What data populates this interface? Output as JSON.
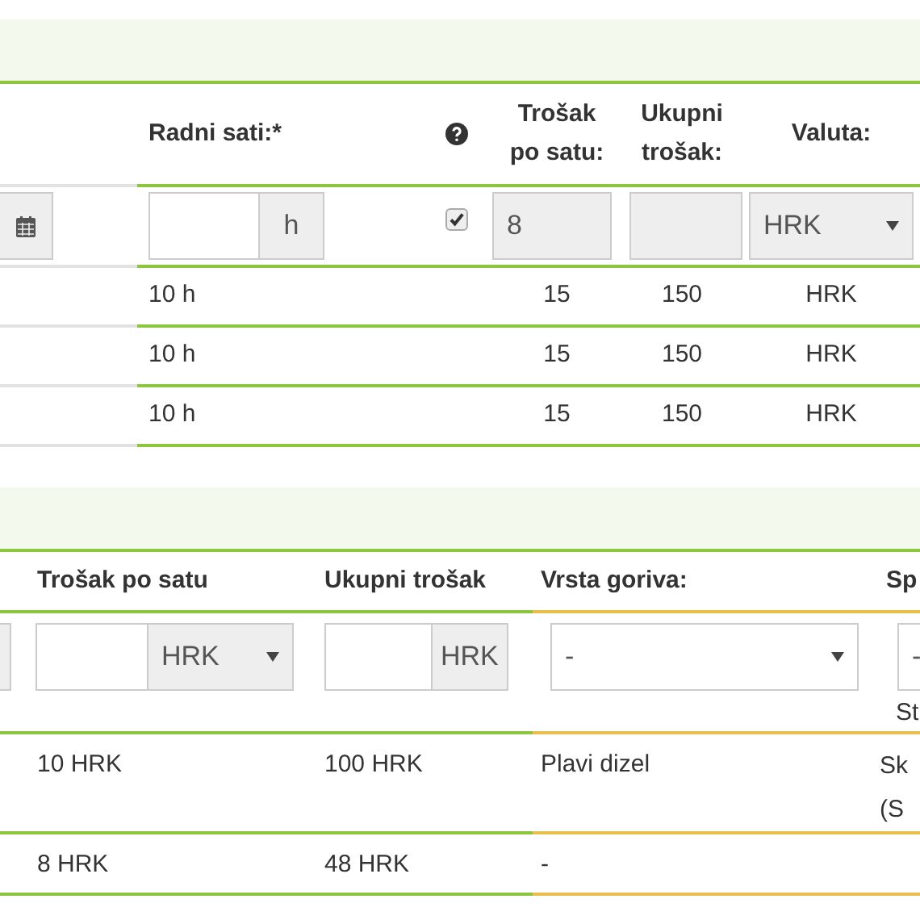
{
  "labour_table": {
    "headers": {
      "hours": "Radni sati:*",
      "hourly_cost": "Trošak po satu:",
      "total_cost": "Ukupni trošak:",
      "currency": "Valuta:"
    },
    "entry": {
      "hours_unit": "h",
      "checked": true,
      "hourly_cost": "8",
      "currency": "HRK"
    },
    "rows": [
      {
        "hours": "10 h",
        "hourly_cost": "15",
        "total_cost": "150",
        "currency": "HRK"
      },
      {
        "hours": "10 h",
        "hourly_cost": "15",
        "total_cost": "150",
        "currency": "HRK"
      },
      {
        "hours": "10 h",
        "hourly_cost": "15",
        "total_cost": "150",
        "currency": "HRK"
      }
    ]
  },
  "cost_table": {
    "headers": {
      "hourly_cost": "Trošak po satu",
      "total_cost": "Ukupni trošak",
      "fuel_type": "Vrsta goriva:",
      "column_5": "Sp"
    },
    "entry": {
      "hourly_currency": "HRK",
      "total_currency": "HRK",
      "fuel_type": "-",
      "column_5_value": "-",
      "column_5_note": "St"
    },
    "rows": [
      {
        "hourly_cost": "10 HRK",
        "total_cost": "100 HRK",
        "fuel_type": "Plavi dizel",
        "column_5": [
          "Sk",
          "(S"
        ]
      },
      {
        "hourly_cost": "8 HRK",
        "total_cost": "48 HRK",
        "fuel_type": "-"
      }
    ]
  }
}
